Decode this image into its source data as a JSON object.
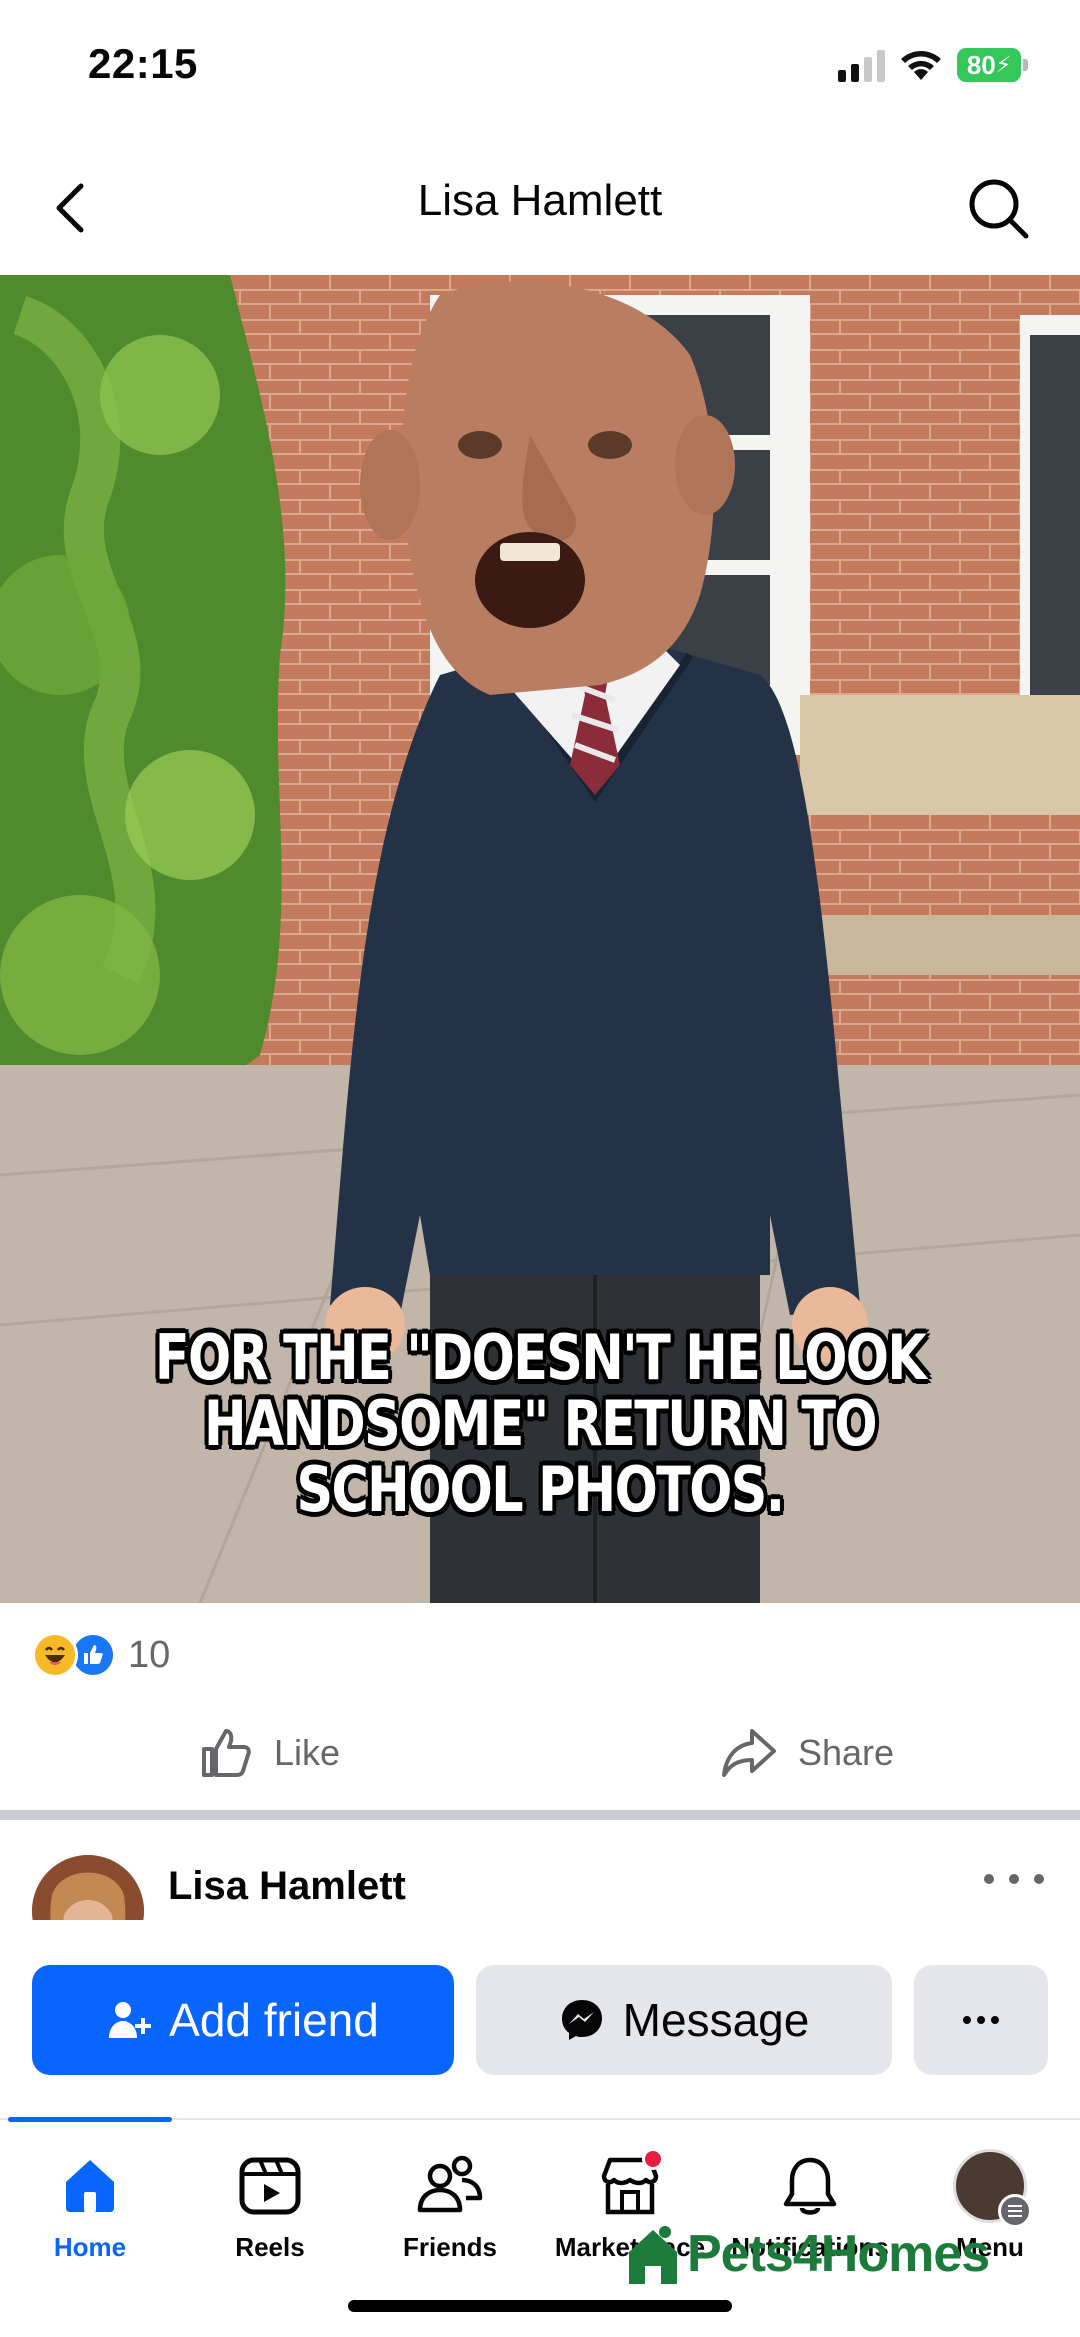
{
  "status_bar": {
    "time": "22:15",
    "battery": "80",
    "icons": [
      "cellular-signal-icon",
      "wifi-icon",
      "battery-charging-icon"
    ]
  },
  "header": {
    "title": "Lisa Hamlett",
    "back_icon": "chevron-left-icon",
    "search_icon": "search-icon"
  },
  "post": {
    "caption_line1": "FOR THE \"DOESN'T HE LOOK",
    "caption_line2": "HANDSOME\" RETURN TO SCHOOL PHOTOS.",
    "reactions": {
      "icons": [
        "haha-reaction-icon",
        "like-reaction-icon"
      ],
      "count": "10"
    },
    "actions": {
      "like_label": "Like",
      "share_label": "Share"
    }
  },
  "profile": {
    "name": "Lisa Hamlett",
    "add_friend_label": "Add friend",
    "message_label": "Message"
  },
  "bottom_nav": {
    "items": [
      {
        "label": "Home",
        "icon": "home-icon",
        "active": true
      },
      {
        "label": "Reels",
        "icon": "reels-icon"
      },
      {
        "label": "Friends",
        "icon": "friends-icon"
      },
      {
        "label": "Marketplace",
        "icon": "marketplace-icon",
        "badge": true
      },
      {
        "label": "Notifications",
        "icon": "bell-icon"
      },
      {
        "label": "Menu",
        "icon": "profile-menu-icon"
      }
    ]
  },
  "watermark": {
    "text": "Pets4Homes"
  },
  "colors": {
    "brand_blue": "#0866ff",
    "secondary_button": "#e4e6eb",
    "muted_text": "#65676b",
    "notification_red": "#e41e3f",
    "watermark_green": "#1c7a3b"
  }
}
